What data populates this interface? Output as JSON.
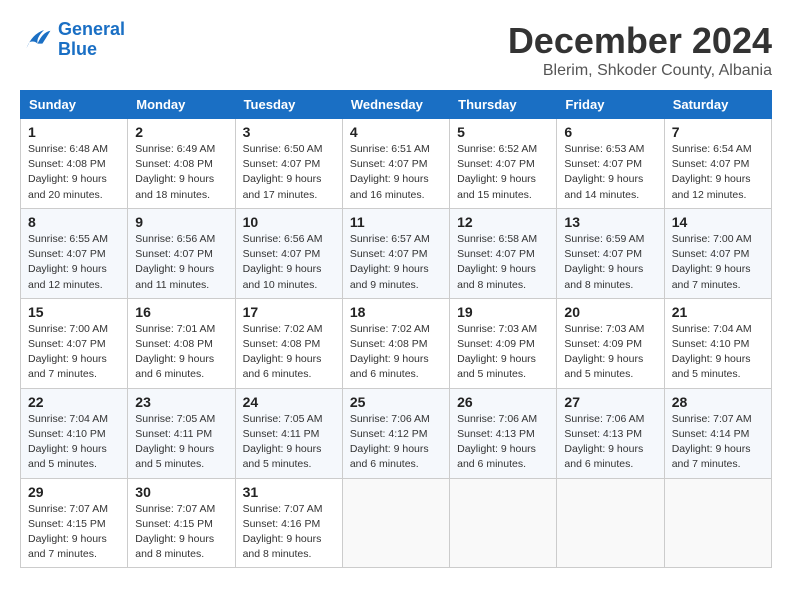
{
  "header": {
    "logo_line1": "General",
    "logo_line2": "Blue",
    "month": "December 2024",
    "location": "Blerim, Shkoder County, Albania"
  },
  "weekdays": [
    "Sunday",
    "Monday",
    "Tuesday",
    "Wednesday",
    "Thursday",
    "Friday",
    "Saturday"
  ],
  "weeks": [
    [
      {
        "day": "1",
        "info": "Sunrise: 6:48 AM\nSunset: 4:08 PM\nDaylight: 9 hours\nand 20 minutes."
      },
      {
        "day": "2",
        "info": "Sunrise: 6:49 AM\nSunset: 4:08 PM\nDaylight: 9 hours\nand 18 minutes."
      },
      {
        "day": "3",
        "info": "Sunrise: 6:50 AM\nSunset: 4:07 PM\nDaylight: 9 hours\nand 17 minutes."
      },
      {
        "day": "4",
        "info": "Sunrise: 6:51 AM\nSunset: 4:07 PM\nDaylight: 9 hours\nand 16 minutes."
      },
      {
        "day": "5",
        "info": "Sunrise: 6:52 AM\nSunset: 4:07 PM\nDaylight: 9 hours\nand 15 minutes."
      },
      {
        "day": "6",
        "info": "Sunrise: 6:53 AM\nSunset: 4:07 PM\nDaylight: 9 hours\nand 14 minutes."
      },
      {
        "day": "7",
        "info": "Sunrise: 6:54 AM\nSunset: 4:07 PM\nDaylight: 9 hours\nand 12 minutes."
      }
    ],
    [
      {
        "day": "8",
        "info": "Sunrise: 6:55 AM\nSunset: 4:07 PM\nDaylight: 9 hours\nand 12 minutes."
      },
      {
        "day": "9",
        "info": "Sunrise: 6:56 AM\nSunset: 4:07 PM\nDaylight: 9 hours\nand 11 minutes."
      },
      {
        "day": "10",
        "info": "Sunrise: 6:56 AM\nSunset: 4:07 PM\nDaylight: 9 hours\nand 10 minutes."
      },
      {
        "day": "11",
        "info": "Sunrise: 6:57 AM\nSunset: 4:07 PM\nDaylight: 9 hours\nand 9 minutes."
      },
      {
        "day": "12",
        "info": "Sunrise: 6:58 AM\nSunset: 4:07 PM\nDaylight: 9 hours\nand 8 minutes."
      },
      {
        "day": "13",
        "info": "Sunrise: 6:59 AM\nSunset: 4:07 PM\nDaylight: 9 hours\nand 8 minutes."
      },
      {
        "day": "14",
        "info": "Sunrise: 7:00 AM\nSunset: 4:07 PM\nDaylight: 9 hours\nand 7 minutes."
      }
    ],
    [
      {
        "day": "15",
        "info": "Sunrise: 7:00 AM\nSunset: 4:07 PM\nDaylight: 9 hours\nand 7 minutes."
      },
      {
        "day": "16",
        "info": "Sunrise: 7:01 AM\nSunset: 4:08 PM\nDaylight: 9 hours\nand 6 minutes."
      },
      {
        "day": "17",
        "info": "Sunrise: 7:02 AM\nSunset: 4:08 PM\nDaylight: 9 hours\nand 6 minutes."
      },
      {
        "day": "18",
        "info": "Sunrise: 7:02 AM\nSunset: 4:08 PM\nDaylight: 9 hours\nand 6 minutes."
      },
      {
        "day": "19",
        "info": "Sunrise: 7:03 AM\nSunset: 4:09 PM\nDaylight: 9 hours\nand 5 minutes."
      },
      {
        "day": "20",
        "info": "Sunrise: 7:03 AM\nSunset: 4:09 PM\nDaylight: 9 hours\nand 5 minutes."
      },
      {
        "day": "21",
        "info": "Sunrise: 7:04 AM\nSunset: 4:10 PM\nDaylight: 9 hours\nand 5 minutes."
      }
    ],
    [
      {
        "day": "22",
        "info": "Sunrise: 7:04 AM\nSunset: 4:10 PM\nDaylight: 9 hours\nand 5 minutes."
      },
      {
        "day": "23",
        "info": "Sunrise: 7:05 AM\nSunset: 4:11 PM\nDaylight: 9 hours\nand 5 minutes."
      },
      {
        "day": "24",
        "info": "Sunrise: 7:05 AM\nSunset: 4:11 PM\nDaylight: 9 hours\nand 5 minutes."
      },
      {
        "day": "25",
        "info": "Sunrise: 7:06 AM\nSunset: 4:12 PM\nDaylight: 9 hours\nand 6 minutes."
      },
      {
        "day": "26",
        "info": "Sunrise: 7:06 AM\nSunset: 4:13 PM\nDaylight: 9 hours\nand 6 minutes."
      },
      {
        "day": "27",
        "info": "Sunrise: 7:06 AM\nSunset: 4:13 PM\nDaylight: 9 hours\nand 6 minutes."
      },
      {
        "day": "28",
        "info": "Sunrise: 7:07 AM\nSunset: 4:14 PM\nDaylight: 9 hours\nand 7 minutes."
      }
    ],
    [
      {
        "day": "29",
        "info": "Sunrise: 7:07 AM\nSunset: 4:15 PM\nDaylight: 9 hours\nand 7 minutes."
      },
      {
        "day": "30",
        "info": "Sunrise: 7:07 AM\nSunset: 4:15 PM\nDaylight: 9 hours\nand 8 minutes."
      },
      {
        "day": "31",
        "info": "Sunrise: 7:07 AM\nSunset: 4:16 PM\nDaylight: 9 hours\nand 8 minutes."
      },
      null,
      null,
      null,
      null
    ]
  ]
}
